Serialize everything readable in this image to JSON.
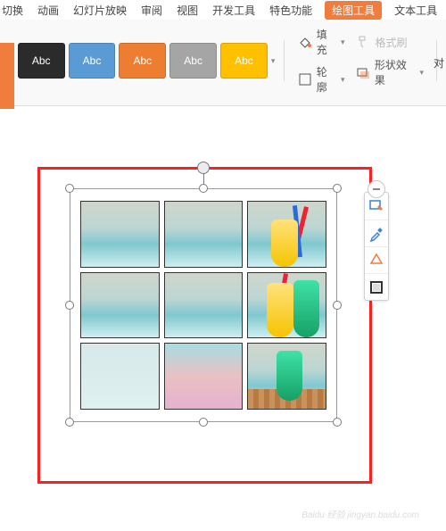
{
  "tabs": {
    "t1": "切换",
    "t2": "动画",
    "t3": "幻灯片放映",
    "t4": "审阅",
    "t5": "视图",
    "t6": "开发工具",
    "t7": "特色功能",
    "t8": "绘图工具",
    "t9": "文本工具"
  },
  "swatch_label": "Abc",
  "ribbon": {
    "fill": "填充",
    "outline": "轮廓",
    "format_painter": "格式刷",
    "shape_effects": "形状效果",
    "overflow": "对"
  },
  "float_icons": {
    "minus": "minus-icon",
    "i1": "picture-properties-icon",
    "i2": "eyedropper-icon",
    "i3": "crop-icon",
    "i4": "border-icon"
  },
  "watermark": "Baidu 经验  jingyan.baidu.com"
}
